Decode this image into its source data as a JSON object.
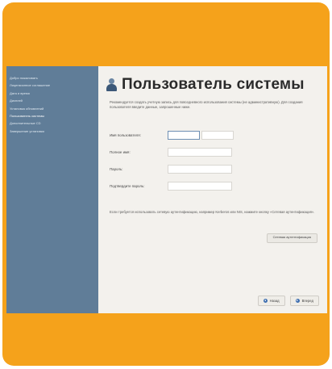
{
  "window": {
    "title": "Пользователь системы"
  },
  "sidebar": {
    "items": [
      {
        "label": "Добро пожаловать"
      },
      {
        "label": "Лицензионное соглашение"
      },
      {
        "label": "Дата и время"
      },
      {
        "label": "Дисплей"
      },
      {
        "label": "Установка обновлений"
      },
      {
        "label": "Пользователь системы"
      },
      {
        "label": "Дополнительные CD"
      },
      {
        "label": "Завершение установки"
      }
    ],
    "active_index": 5
  },
  "main": {
    "description": "Рекомендуется создать учетную запись для повседневного использования системы (не административную). Для создания пользователя введите данные, запрошенные ниже.",
    "form": {
      "username_label": "Имя пользователя:",
      "fullname_label": "Полное имя:",
      "password_label": "Пароль:",
      "confirm_label": "Подтвердите пароль:"
    },
    "note": "Если требуется использовать сетевую аутентификацию, например Kerberos или NIS, нажмите кнопку «Сетевая аутентификация».",
    "network_button_label": "Сетевая аутентификация"
  },
  "footer": {
    "back_label": "Назад",
    "next_label": "Вперед"
  },
  "colors": {
    "frame": "#f5a21b",
    "sidebar": "#607d98",
    "content_bg": "#f3f1ed",
    "nav_arrow": "#3f6fb0"
  }
}
